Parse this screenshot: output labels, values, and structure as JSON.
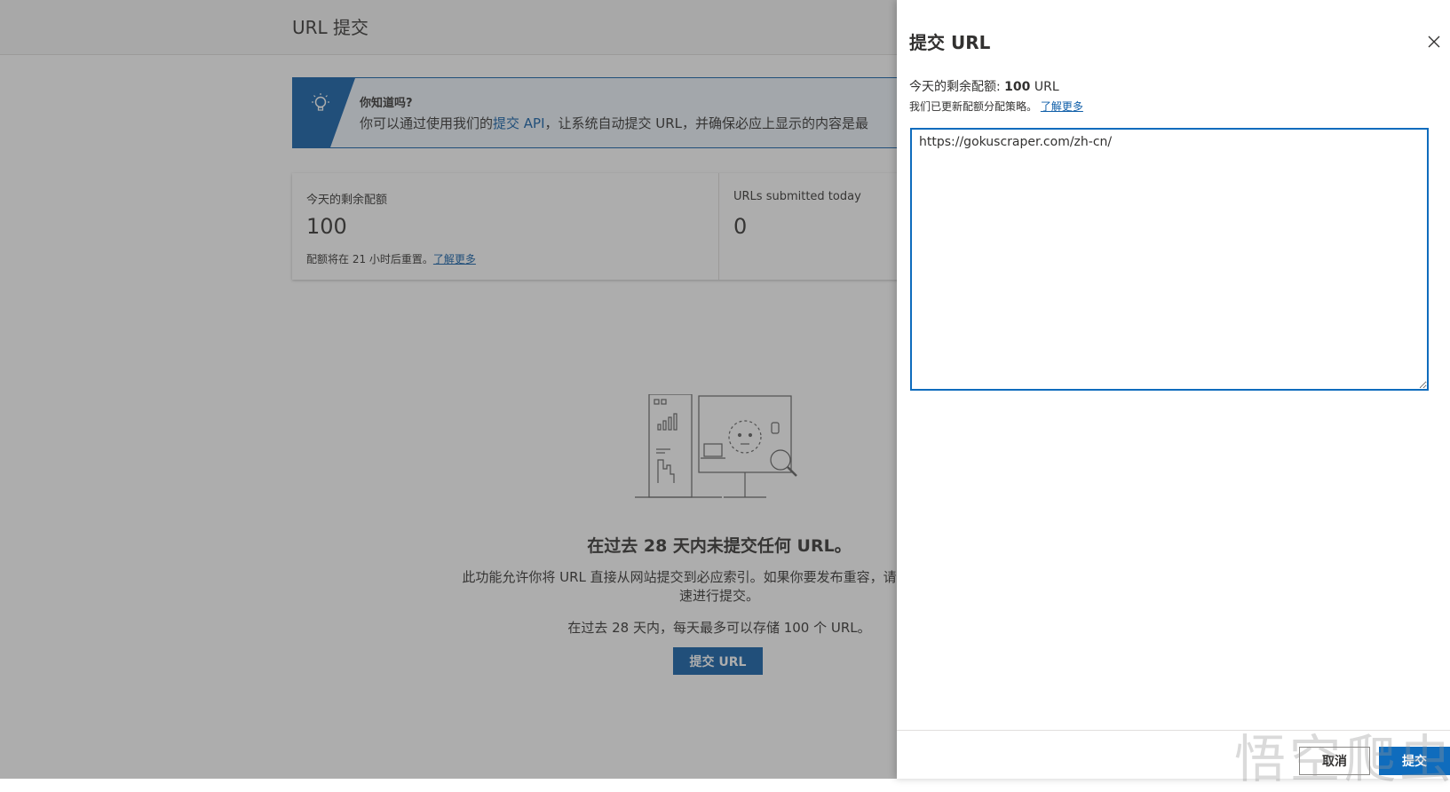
{
  "page": {
    "title": "URL 提交",
    "banner": {
      "heading": "你知道吗?",
      "text_before": "你可以通过使用我们的",
      "api_link": "提交 API",
      "text_after": "，让系统自动提交 URL，并确保必应上显示的内容是最"
    },
    "cards": [
      {
        "label": "今天的剩余配额",
        "value": "100",
        "note": "配额将在 21 小时后重置。",
        "link": "了解更多"
      },
      {
        "label": "URLs submitted today",
        "value": "0"
      }
    ],
    "empty_state": {
      "title": "在过去 28 天内未提交任何 URL。",
      "description": "此功能允许你将 URL 直接从网站提交到必应索引。如果你要发布重容，请使用此功能快速进行提交。",
      "note": "在过去 28 天内，每天最多可以存储 100 个 URL。",
      "button": "提交 URL"
    }
  },
  "panel": {
    "title": "提交 URL",
    "quota_label": "今天的剩余配额: ",
    "quota_value": "100",
    "quota_unit": " URL",
    "policy_text": "我们已更新配额分配策略。",
    "policy_link": "了解更多",
    "textarea_value": "https://gokuscraper.com/zh-cn/",
    "cancel_label": "取消",
    "submit_label": "提交"
  },
  "watermark": "悟空爬虫",
  "colors": {
    "brand": "#0f5ea8",
    "overlay": "rgba(60,60,60,0.42)",
    "submit": "#0f6cbd"
  },
  "icons": {
    "banner": "lightbulb-icon",
    "close": "close-icon"
  }
}
